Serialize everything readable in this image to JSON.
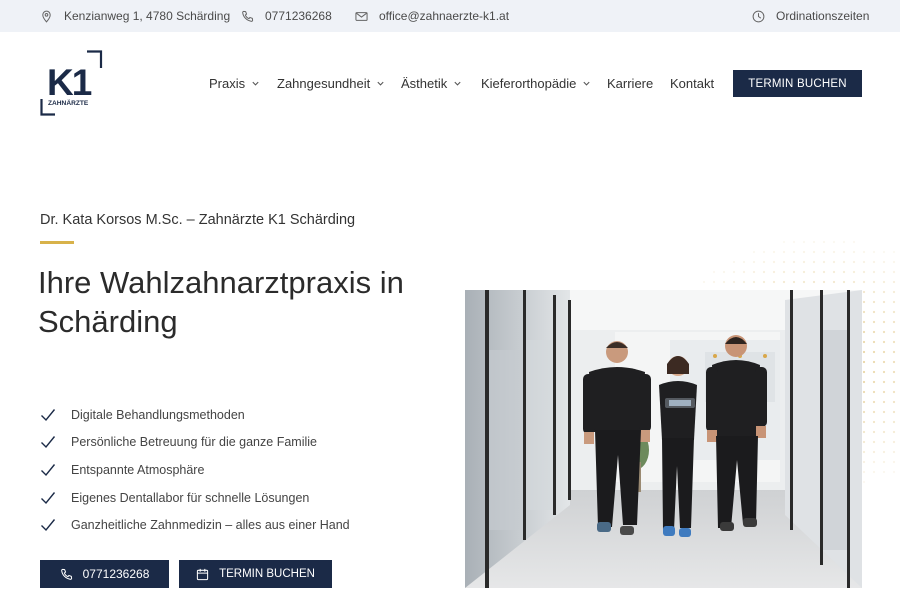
{
  "topbar": {
    "address": "Kenzianweg 1, 4780 Schärding",
    "phone": "0771236268",
    "email": "office@zahnaerzte-k1.at",
    "hours": "Ordinationszeiten"
  },
  "logo": {
    "mark": "K1",
    "sub": "ZAHNÄRZTE"
  },
  "nav": {
    "items": [
      "Praxis",
      "Zahngesundheit",
      "Ästhetik",
      "Kieferorthopädie",
      "Karriere",
      "Kontakt"
    ],
    "cta": "TERMIN BUCHEN"
  },
  "hero": {
    "subtitle": "Dr. Kata Korsos M.Sc. – Zahnärzte K1 Schärding",
    "title": "Ihre Wahlzahnarztpraxis in Schärding",
    "features": [
      "Digitale Behandlungsmethoden",
      "Persönliche Betreuung für die ganze Familie",
      "Entspannte Atmosphäre",
      "Eigenes Dentallabor für schnelle Lösungen",
      "Ganzheitliche Zahnmedizin – alles aus einer Hand"
    ],
    "call_label": "0771236268",
    "book_label": "TERMIN BUCHEN"
  },
  "colors": {
    "primary": "#1b2a47",
    "accent": "#d8b24a",
    "topbar_bg": "#eff2f7"
  }
}
